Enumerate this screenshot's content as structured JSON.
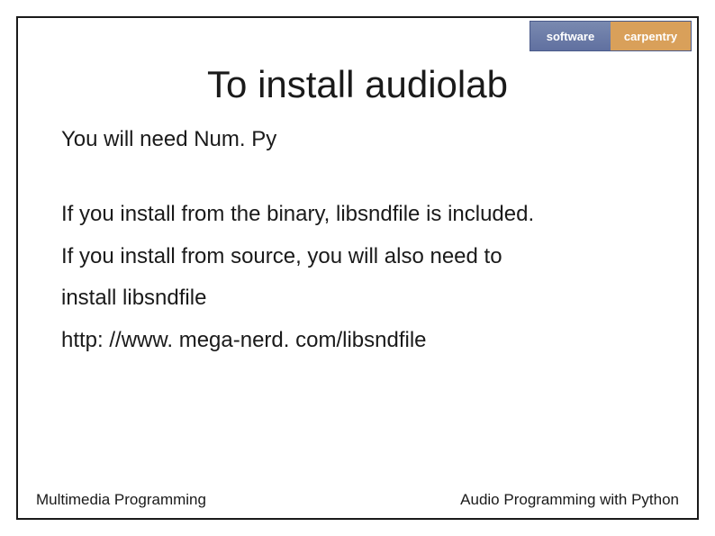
{
  "logo": {
    "left": "software",
    "right": "carpentry"
  },
  "title": "To install audiolab",
  "body": {
    "line1": "You will need Num. Py",
    "line2": "If you install from the binary, libsndfile is included.",
    "line3": "If you install from source, you will also need to",
    "line4": "install libsndfile",
    "line5": "http: //www. mega-nerd. com/libsndfile"
  },
  "footer": {
    "left": "Multimedia Programming",
    "right": "Audio Programming with Python"
  }
}
